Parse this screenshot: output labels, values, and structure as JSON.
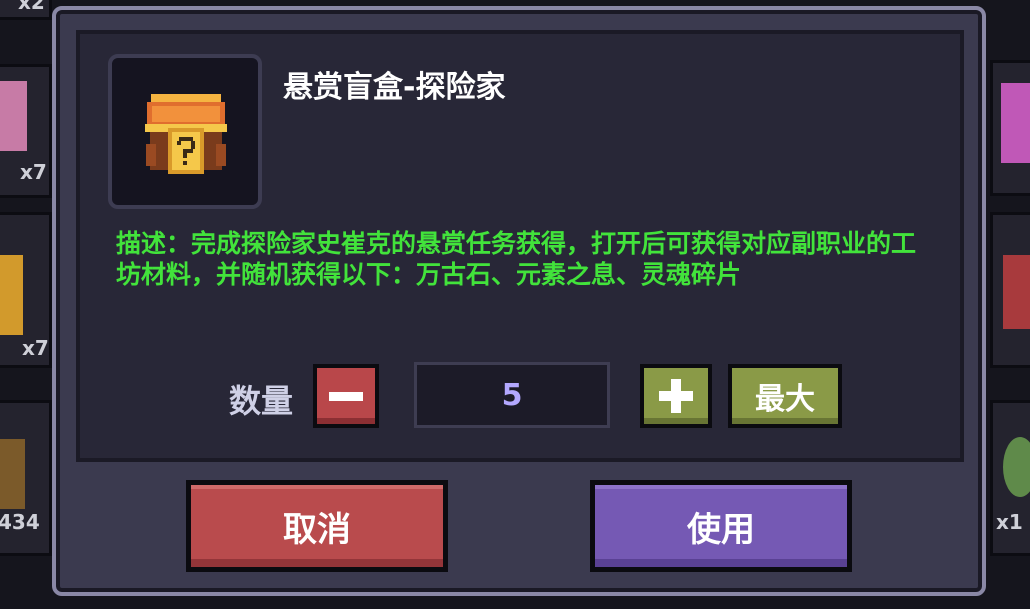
{
  "background": {
    "left_counts": [
      "x2",
      "x7",
      "x7",
      "434"
    ],
    "right_counts": [
      "x1"
    ]
  },
  "dialog": {
    "item": {
      "icon": "mystery-chest-icon",
      "title": "悬赏盲盒-探险家",
      "description": "描述：完成探险家史崔克的悬赏任务获得，打开后可获得对应副职业的工坊材料，并随机获得以下：万古石、元素之息、灵魂碎片"
    },
    "quantity": {
      "label": "数量",
      "value": "5",
      "minus_icon": "minus-icon",
      "plus_icon": "plus-icon",
      "max_label": "最大"
    },
    "buttons": {
      "cancel_label": "取消",
      "use_label": "使用"
    },
    "colors": {
      "description": "#42e33b",
      "cancel": "#b94b4d",
      "use": "#7559b4",
      "plus_max": "#8a9a47",
      "minus": "#b9474a"
    }
  }
}
